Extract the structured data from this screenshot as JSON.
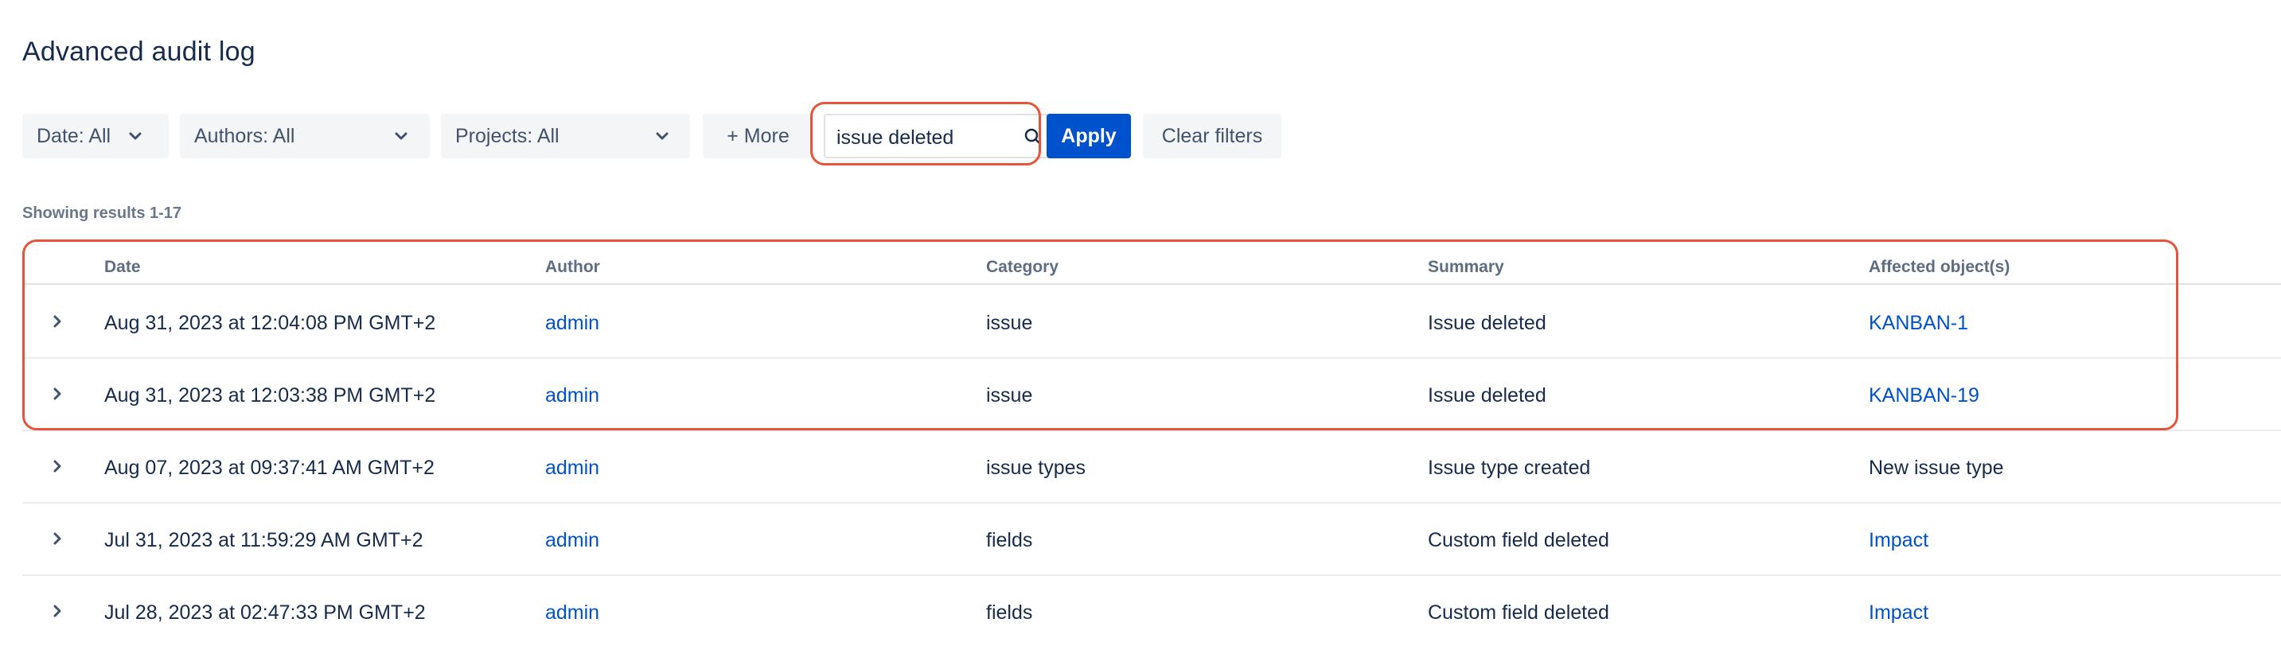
{
  "page": {
    "title": "Advanced audit log",
    "results_text": "Showing results 1-17"
  },
  "filters": {
    "date_label": "Date: All",
    "authors_label": "Authors: All",
    "projects_label": "Projects: All",
    "more_label": "+ More",
    "search_value": "issue deleted",
    "apply_label": "Apply",
    "clear_label": "Clear filters"
  },
  "table": {
    "columns": [
      "Date",
      "Author",
      "Category",
      "Summary",
      "Affected object(s)"
    ],
    "rows": [
      {
        "date": "Aug 31, 2023 at 12:04:08 PM GMT+2",
        "author": "admin",
        "category": "issue",
        "summary": "Issue deleted",
        "affected": "KANBAN-1",
        "affected_is_link": true
      },
      {
        "date": "Aug 31, 2023 at 12:03:38 PM GMT+2",
        "author": "admin",
        "category": "issue",
        "summary": "Issue deleted",
        "affected": "KANBAN-19",
        "affected_is_link": true
      },
      {
        "date": "Aug 07, 2023 at 09:37:41 AM GMT+2",
        "author": "admin",
        "category": "issue types",
        "summary": "Issue type created",
        "affected": "New issue type",
        "affected_is_link": false
      },
      {
        "date": "Jul 31, 2023 at 11:59:29 AM GMT+2",
        "author": "admin",
        "category": "fields",
        "summary": "Custom field deleted",
        "affected": "Impact",
        "affected_is_link": true
      },
      {
        "date": "Jul 28, 2023 at 02:47:33 PM GMT+2",
        "author": "admin",
        "category": "fields",
        "summary": "Custom field deleted",
        "affected": "Impact",
        "affected_is_link": true
      }
    ]
  },
  "colors": {
    "primary": "#0052cc",
    "link": "#0052cc",
    "highlight": "#e5543b",
    "text": "#172b4d"
  },
  "icons": {
    "dropdown": "chevron-down-icon",
    "search": "search-icon",
    "expand": "chevron-right-icon"
  }
}
